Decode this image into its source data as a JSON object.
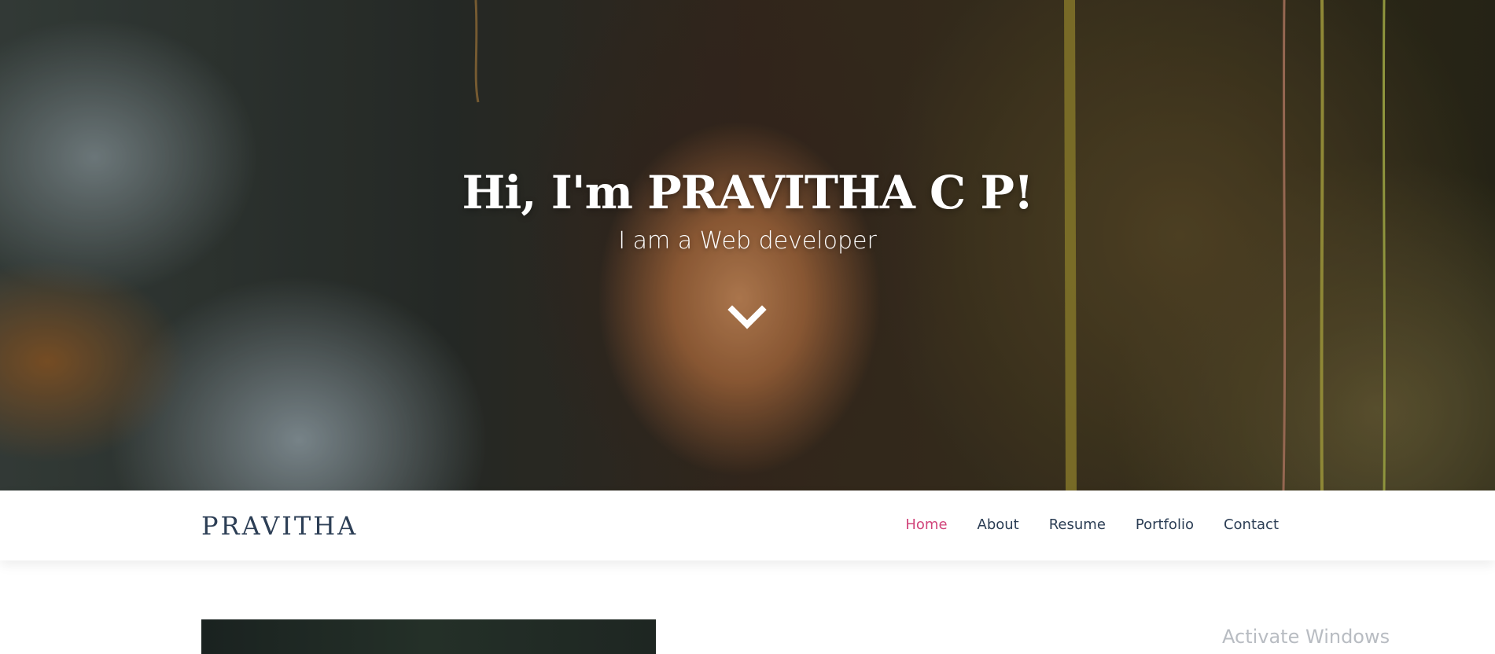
{
  "hero": {
    "title": "Hi, I'm PRAVITHA C P!",
    "subtitle": "I am a Web developer",
    "scroll_icon": "chevron-down-icon"
  },
  "navbar": {
    "brand": "PRAVITHA",
    "items": [
      {
        "label": "Home",
        "active": true
      },
      {
        "label": "About",
        "active": false
      },
      {
        "label": "Resume",
        "active": false
      },
      {
        "label": "Portfolio",
        "active": false
      },
      {
        "label": "Contact",
        "active": false
      }
    ],
    "active_color": "#d1447a",
    "text_color": "#2c3e55"
  },
  "watermark": {
    "text": "Activate Windows"
  }
}
